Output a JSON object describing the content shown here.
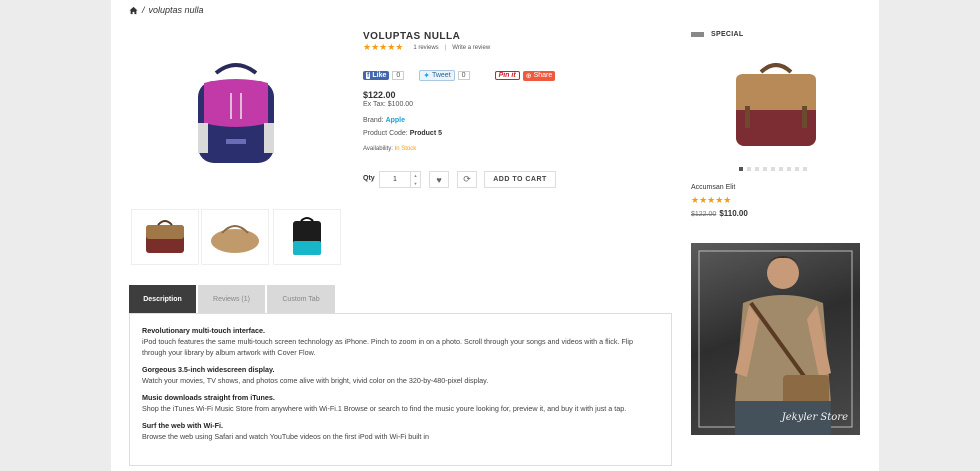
{
  "breadcrumb": {
    "current": "voluptas nulla"
  },
  "product": {
    "title": "VOLUPTAS NULLA",
    "rating_stars": "★★★★★",
    "reviews_link": "1 reviews",
    "separator": "|",
    "write_review_link": "Write a review",
    "price": "$122.00",
    "ex_tax": "Ex Tax: $100.00",
    "brand_label": "Brand:",
    "brand_value": "Apple",
    "code_label": "Product Code:",
    "code_value": "Product 5",
    "availability_label": "Availability:",
    "availability_value": "In Stock",
    "qty_label": "Qty",
    "qty_value": "1",
    "add_to_cart": "ADD TO CART"
  },
  "social": {
    "fb_label": "Like",
    "fb_count": "0",
    "tweet_label": "Tweet",
    "tweet_count": "0",
    "pin_label": "Pin it",
    "share_label": "Share"
  },
  "tabs": [
    {
      "label": "Description"
    },
    {
      "label": "Reviews (1)"
    },
    {
      "label": "Custom Tab"
    }
  ],
  "description": [
    {
      "heading": "Revolutionary multi-touch interface.",
      "text": "iPod touch features the same multi-touch screen technology as iPhone. Pinch to zoom in on a photo. Scroll through your songs and videos with a flick. Flip through your library by album artwork with Cover Flow."
    },
    {
      "heading": "Gorgeous 3.5-inch widescreen display.",
      "text": "Watch your movies, TV shows, and photos come alive with bright, vivid color on the 320-by-480-pixel display."
    },
    {
      "heading": "Music downloads straight from iTunes.",
      "text": "Shop the iTunes Wi-Fi Music Store from anywhere with Wi-Fi.1 Browse or search to find the music youre looking for, preview it, and buy it with just a tap."
    },
    {
      "heading": "Surf the web with Wi-Fi.",
      "text": "Browse the web using Safari and watch YouTube videos on the first iPod with Wi-Fi built in"
    }
  ],
  "sidebar": {
    "special_title": "SPECIAL",
    "product_name": "Accumsan Elit",
    "stars": "★★★★★",
    "old_price": "$122.00",
    "new_price": "$110.00",
    "banner_signature": "Jekyler Store"
  },
  "colors": {
    "accent_star": "#f39c12",
    "brand_link": "#1a9fd6",
    "tab_active": "#3d3d3d"
  }
}
